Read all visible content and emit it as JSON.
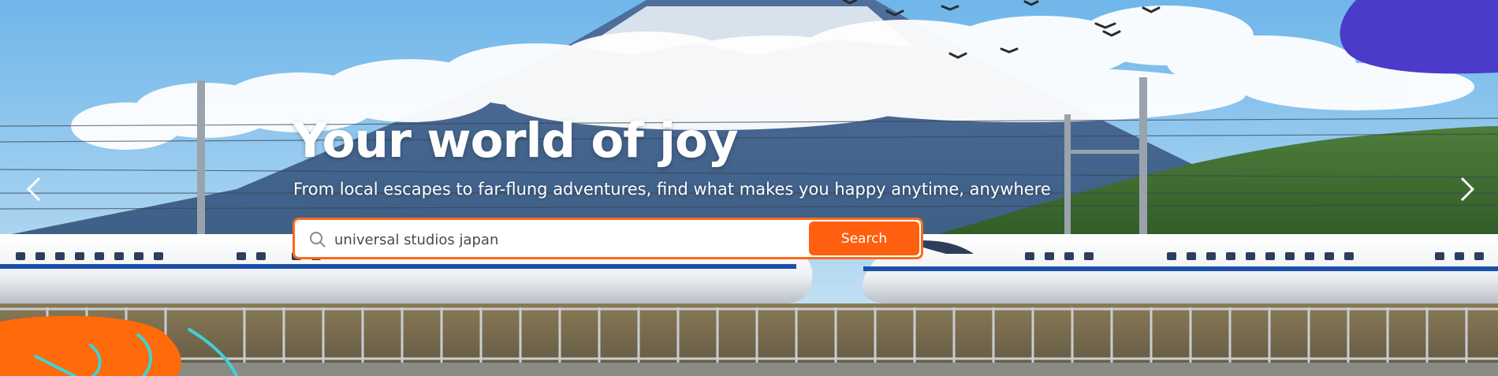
{
  "hero": {
    "headline": "Your world of joy",
    "subheadline": "From local escapes to far-flung adventures, find what makes you happy anytime, anywhere"
  },
  "search": {
    "value": "universal studios japan",
    "placeholder": "universal studios japan",
    "button_label": "Search"
  },
  "carousel": {
    "prev_icon": "chevron-left-icon",
    "next_icon": "chevron-right-icon"
  },
  "colors": {
    "accent": "#ff5f0e",
    "blob_purple": "#4a3bc9",
    "blob_orange": "#ff6a0a",
    "squiggle": "#3fd2d6"
  }
}
